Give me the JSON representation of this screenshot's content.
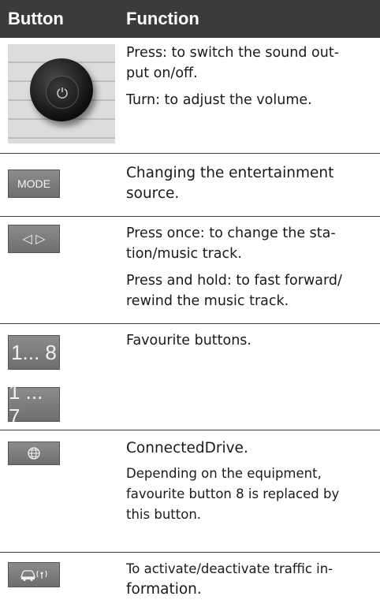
{
  "header": {
    "col1": "Button",
    "col2": "Function"
  },
  "rows": [
    {
      "button": "power-volume-knob",
      "lines": [
        "Press: to switch the sound out-",
        "put on/off.",
        "Turn: to adjust the volume."
      ]
    },
    {
      "button": "MODE",
      "lines": [
        "Changing the entertainment",
        "source."
      ]
    },
    {
      "button": "◁   ▷",
      "lines": [
        "Press once: to change the sta-",
        "tion/music track.",
        "Press and hold: to fast forward/",
        "rewind the music track."
      ]
    },
    {
      "button_a": "1... 8",
      "button_b": "1 ... 7",
      "lines": [
        "Favourite  buttons."
      ]
    },
    {
      "button": "globe-icon",
      "lines": [
        "ConnectedDrive.",
        "Depending on the equipment,",
        "favourite button 8 is replaced by",
        "this button."
      ]
    },
    {
      "button": "traffic-info-icon",
      "lines": [
        "To activate/deactivate traffic in-",
        "formation."
      ]
    }
  ]
}
